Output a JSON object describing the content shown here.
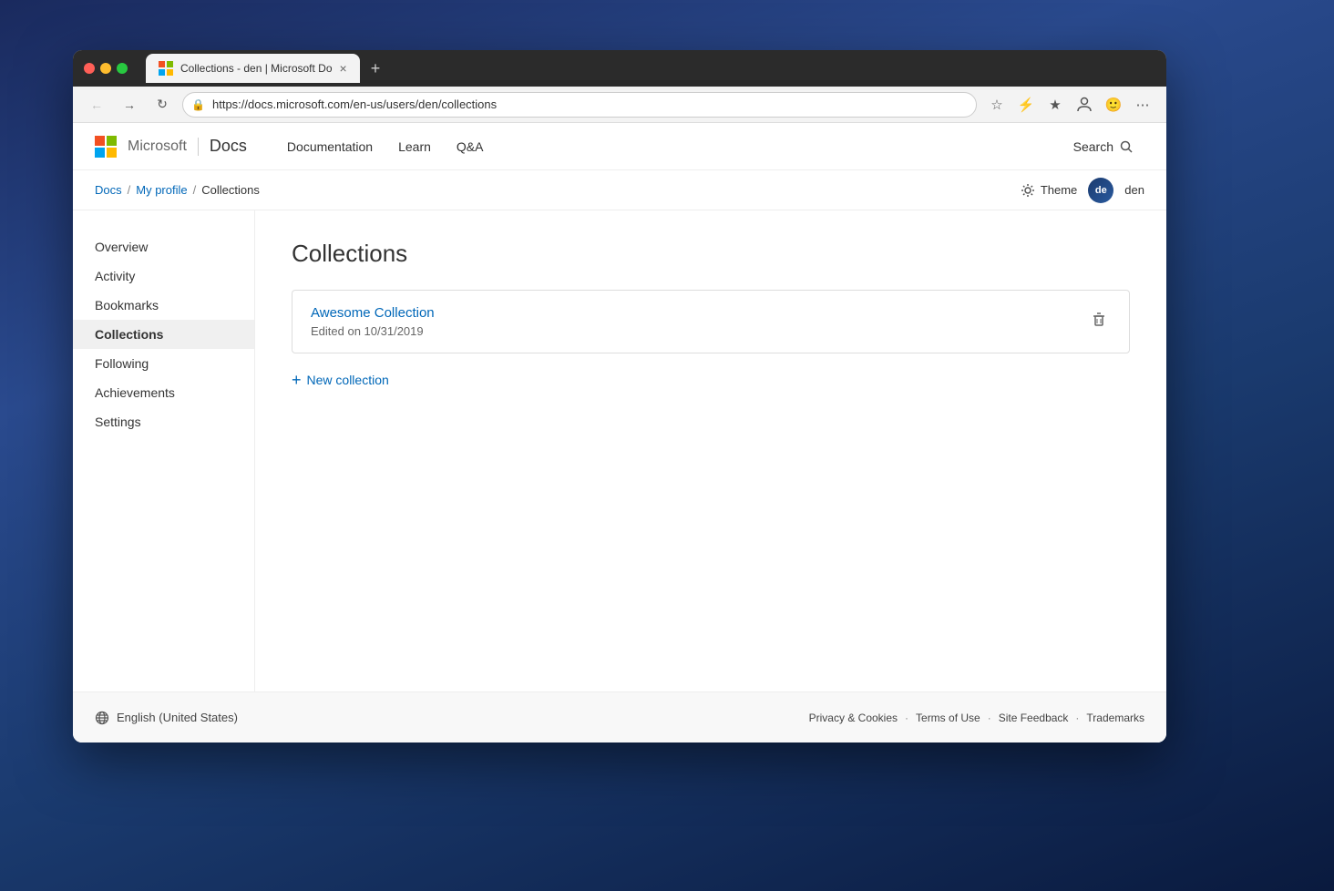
{
  "desktop": {
    "bg": "cityscape"
  },
  "browser": {
    "tab": {
      "title": "Collections - den | Microsoft Do",
      "url": "https://docs.microsoft.com/en-us/users/den/collections"
    },
    "new_tab_label": "+"
  },
  "nav": {
    "brand": {
      "docs_label": "Docs"
    },
    "links": [
      {
        "label": "Documentation",
        "key": "documentation"
      },
      {
        "label": "Learn",
        "key": "learn"
      },
      {
        "label": "Q&A",
        "key": "qa"
      }
    ],
    "search_label": "Search",
    "theme_label": "Theme",
    "user_name": "den",
    "user_initials": "de"
  },
  "breadcrumb": {
    "items": [
      {
        "label": "Docs",
        "key": "docs"
      },
      {
        "label": "My profile",
        "key": "my-profile"
      },
      {
        "label": "Collections",
        "key": "collections"
      }
    ]
  },
  "sidebar": {
    "items": [
      {
        "label": "Overview",
        "key": "overview",
        "active": false
      },
      {
        "label": "Activity",
        "key": "activity",
        "active": false
      },
      {
        "label": "Bookmarks",
        "key": "bookmarks",
        "active": false
      },
      {
        "label": "Collections",
        "key": "collections",
        "active": true
      },
      {
        "label": "Following",
        "key": "following",
        "active": false
      },
      {
        "label": "Achievements",
        "key": "achievements",
        "active": false
      },
      {
        "label": "Settings",
        "key": "settings",
        "active": false
      }
    ]
  },
  "collections_page": {
    "title": "Collections",
    "collection": {
      "name": "Awesome Collection",
      "edited": "Edited on 10/31/2019"
    },
    "new_collection_label": "New collection"
  },
  "footer": {
    "locale": "English (United States)",
    "links": [
      {
        "label": "Privacy & Cookies",
        "key": "privacy"
      },
      {
        "label": "Terms of Use",
        "key": "terms"
      },
      {
        "label": "Site Feedback",
        "key": "feedback"
      },
      {
        "label": "Trademarks",
        "key": "trademarks"
      }
    ]
  }
}
